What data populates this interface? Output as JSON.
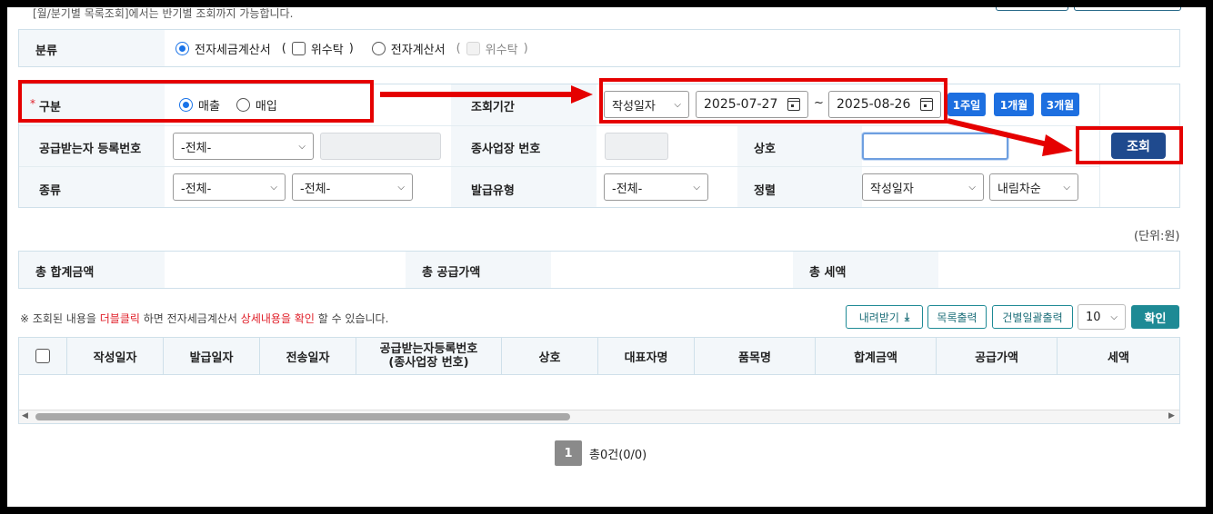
{
  "notice_top": "[월/분기별 목록조회]에서는 반기별 조회까지 가능합니다.",
  "category": {
    "label": "분류",
    "opt1": "전자세금계산서",
    "opt1_sub": "위수탁",
    "opt2": "전자계산서",
    "opt2_sub": "위수탁",
    "paren_open": "(",
    "paren_close": ")"
  },
  "filter": {
    "required_mark": "*",
    "type_label": "구분",
    "type_sale": "매출",
    "type_buy": "매입",
    "period_label": "조회기간",
    "date_type": "작성일자",
    "date_from": "2025-07-27",
    "tilde": "~",
    "date_to": "2025-08-26",
    "q_1w": "1주일",
    "q_1m": "1개월",
    "q_3m": "3개월",
    "supplier_label": "공급받는자 등록번호",
    "supplier_sel": "-전체-",
    "branch_label": "종사업장 번호",
    "company_label": "상호",
    "search_btn": "조회",
    "kind_label": "종류",
    "kind_sel1": "-전체-",
    "kind_sel2": "-전체-",
    "issue_label": "발급유형",
    "issue_sel": "-전체-",
    "sort_label": "정렬",
    "sort_field": "작성일자",
    "sort_order": "내림차순"
  },
  "unit_text": "(단위:원)",
  "totals": {
    "sum_label": "총 합계금액",
    "supply_label": "총 공급가액",
    "tax_label": "총 세액"
  },
  "hint": {
    "prefix": "※ 조회된 내용을",
    "dbl": "더블클릭",
    "mid": "하면 전자세금계산서",
    "detail": "상세내용을 확인",
    "suffix": "할 수 있습니다."
  },
  "actions": {
    "download": "내려받기",
    "print_list": "목록출력",
    "batch_print": "건별일괄출력",
    "page_size": "10",
    "confirm": "확인"
  },
  "table": {
    "columns": [
      "작성일자",
      "발급일자",
      "전송일자",
      "공급받는자등록번호\n(종사업장 번호)",
      "상호",
      "대표자명",
      "품목명",
      "합계금액",
      "공급가액",
      "세액"
    ]
  },
  "pager": {
    "page": "1",
    "summary": "총0건(0/0)"
  },
  "colors": {
    "accent_blue": "#1d6fe0",
    "search_btn": "#1f4a8e",
    "teal": "#1e8a95",
    "highlight_red": "#e50000"
  }
}
